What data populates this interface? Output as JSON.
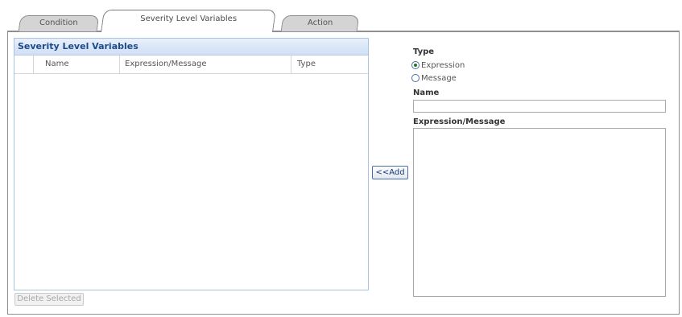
{
  "tabs": [
    {
      "label": "Condition",
      "active": false
    },
    {
      "label": "Severity Level Variables",
      "active": true
    },
    {
      "label": "Action",
      "active": false
    }
  ],
  "table": {
    "title": "Severity Level Variables",
    "columns": [
      "Name",
      "Expression/Message",
      "Type"
    ],
    "rows": []
  },
  "delete_button": "Delete Selected",
  "add_button": "<<Add",
  "form": {
    "type_label": "Type",
    "type_options": [
      "Expression",
      "Message"
    ],
    "selected_type": "Expression",
    "name_label": "Name",
    "name_value": "",
    "expression_label": "Expression/Message",
    "expression_value": ""
  }
}
